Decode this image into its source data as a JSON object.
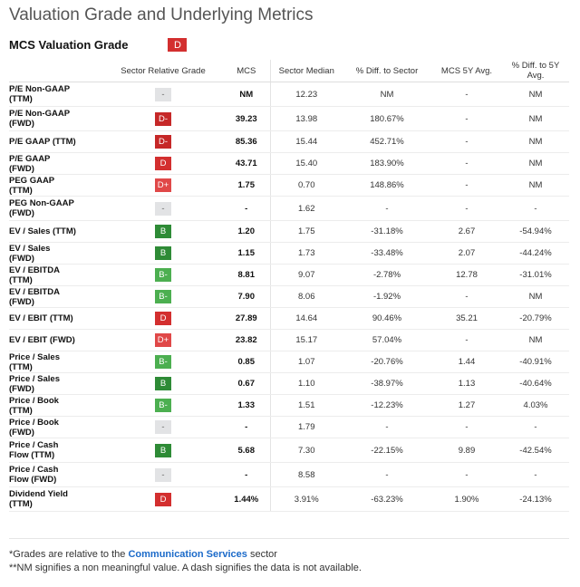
{
  "title": "Valuation Grade and Underlying Metrics",
  "valuation_grade": {
    "label": "MCS Valuation Grade",
    "grade": "D"
  },
  "columns": [
    "",
    "Sector Relative Grade",
    "MCS",
    "Sector Median",
    "% Diff. to Sector",
    "MCS 5Y Avg.",
    "% Diff. to 5Y Avg."
  ],
  "rows": [
    {
      "metric": "P/E Non-GAAP (TTM)",
      "grade": "-",
      "grade_class": "na",
      "mcs": "NM",
      "sector_median": "12.23",
      "diff_sector": "NM",
      "avg5y": "-",
      "diff_5y": "NM"
    },
    {
      "metric": "P/E Non-GAAP (FWD)",
      "grade": "D-",
      "grade_class": "Dm",
      "mcs": "39.23",
      "sector_median": "13.98",
      "diff_sector": "180.67%",
      "avg5y": "-",
      "diff_5y": "NM"
    },
    {
      "metric": "P/E GAAP (TTM)",
      "grade": "D-",
      "grade_class": "Dm",
      "mcs": "85.36",
      "sector_median": "15.44",
      "diff_sector": "452.71%",
      "avg5y": "-",
      "diff_5y": "NM"
    },
    {
      "metric": "P/E GAAP (FWD)",
      "grade": "D",
      "grade_class": "D",
      "mcs": "43.71",
      "sector_median": "15.40",
      "diff_sector": "183.90%",
      "avg5y": "-",
      "diff_5y": "NM"
    },
    {
      "metric": "PEG GAAP (TTM)",
      "grade": "D+",
      "grade_class": "Dp",
      "mcs": "1.75",
      "sector_median": "0.70",
      "diff_sector": "148.86%",
      "avg5y": "-",
      "diff_5y": "NM"
    },
    {
      "metric": "PEG Non-GAAP (FWD)",
      "grade": "-",
      "grade_class": "na",
      "mcs": "-",
      "sector_median": "1.62",
      "diff_sector": "-",
      "avg5y": "-",
      "diff_5y": "-"
    },
    {
      "metric": "EV / Sales (TTM)",
      "grade": "B",
      "grade_class": "B",
      "mcs": "1.20",
      "sector_median": "1.75",
      "diff_sector": "-31.18%",
      "avg5y": "2.67",
      "diff_5y": "-54.94%"
    },
    {
      "metric": "EV / Sales (FWD)",
      "grade": "B",
      "grade_class": "B",
      "mcs": "1.15",
      "sector_median": "1.73",
      "diff_sector": "-33.48%",
      "avg5y": "2.07",
      "diff_5y": "-44.24%"
    },
    {
      "metric": "EV / EBITDA (TTM)",
      "grade": "B-",
      "grade_class": "Bm",
      "mcs": "8.81",
      "sector_median": "9.07",
      "diff_sector": "-2.78%",
      "avg5y": "12.78",
      "diff_5y": "-31.01%"
    },
    {
      "metric": "EV / EBITDA (FWD)",
      "grade": "B-",
      "grade_class": "Bm",
      "mcs": "7.90",
      "sector_median": "8.06",
      "diff_sector": "-1.92%",
      "avg5y": "-",
      "diff_5y": "NM"
    },
    {
      "metric": "EV / EBIT (TTM)",
      "grade": "D",
      "grade_class": "D",
      "mcs": "27.89",
      "sector_median": "14.64",
      "diff_sector": "90.46%",
      "avg5y": "35.21",
      "diff_5y": "-20.79%"
    },
    {
      "metric": "EV / EBIT (FWD)",
      "grade": "D+",
      "grade_class": "Dp",
      "mcs": "23.82",
      "sector_median": "15.17",
      "diff_sector": "57.04%",
      "avg5y": "-",
      "diff_5y": "NM"
    },
    {
      "metric": "Price / Sales (TTM)",
      "grade": "B-",
      "grade_class": "Bm",
      "mcs": "0.85",
      "sector_median": "1.07",
      "diff_sector": "-20.76%",
      "avg5y": "1.44",
      "diff_5y": "-40.91%"
    },
    {
      "metric": "Price / Sales (FWD)",
      "grade": "B",
      "grade_class": "B",
      "mcs": "0.67",
      "sector_median": "1.10",
      "diff_sector": "-38.97%",
      "avg5y": "1.13",
      "diff_5y": "-40.64%"
    },
    {
      "metric": "Price / Book (TTM)",
      "grade": "B-",
      "grade_class": "Bm",
      "mcs": "1.33",
      "sector_median": "1.51",
      "diff_sector": "-12.23%",
      "avg5y": "1.27",
      "diff_5y": "4.03%"
    },
    {
      "metric": "Price / Book (FWD)",
      "grade": "-",
      "grade_class": "na",
      "mcs": "-",
      "sector_median": "1.79",
      "diff_sector": "-",
      "avg5y": "-",
      "diff_5y": "-"
    },
    {
      "metric": "Price / Cash Flow (TTM)",
      "grade": "B",
      "grade_class": "B",
      "mcs": "5.68",
      "sector_median": "7.30",
      "diff_sector": "-22.15%",
      "avg5y": "9.89",
      "diff_5y": "-42.54%"
    },
    {
      "metric": "Price / Cash Flow (FWD)",
      "grade": "-",
      "grade_class": "na",
      "mcs": "-",
      "sector_median": "8.58",
      "diff_sector": "-",
      "avg5y": "-",
      "diff_5y": "-"
    },
    {
      "metric": "Dividend Yield (TTM)",
      "grade": "D",
      "grade_class": "D",
      "mcs": "1.44%",
      "sector_median": "3.91%",
      "diff_sector": "-63.23%",
      "avg5y": "1.90%",
      "diff_5y": "-24.13%"
    }
  ],
  "tall_rows": [
    0,
    1,
    5,
    16,
    17,
    18
  ],
  "footnotes": {
    "line1_prefix": "*Grades are relative to the ",
    "sector_link": "Communication Services",
    "line1_suffix": " sector",
    "line2": "**NM signifies a non meaningful value. A dash signifies the data is not available."
  }
}
